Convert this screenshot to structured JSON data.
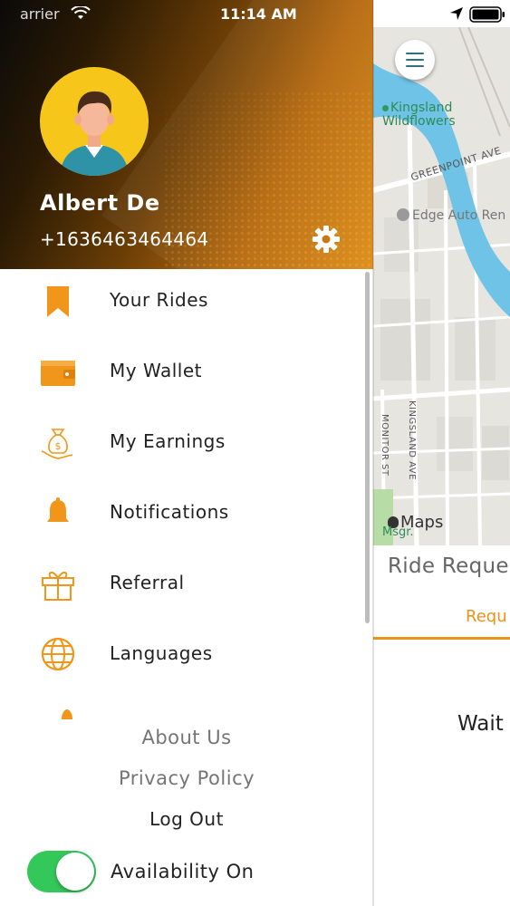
{
  "status_bar": {
    "carrier": "arrier",
    "time": "11:14 AM"
  },
  "profile": {
    "name": "Albert De",
    "phone": "+1636463464464"
  },
  "menu": [
    {
      "label": "Your Rides",
      "icon": "bookmark-icon"
    },
    {
      "label": "My Wallet",
      "icon": "wallet-icon"
    },
    {
      "label": "My Earnings",
      "icon": "money-bag-icon"
    },
    {
      "label": "Notifications",
      "icon": "bell-icon"
    },
    {
      "label": "Referral",
      "icon": "gift-icon"
    },
    {
      "label": "Languages",
      "icon": "globe-icon"
    }
  ],
  "footer": {
    "about": "About Us",
    "privacy": "Privacy Policy",
    "logout": "Log Out",
    "availability_label": "Availability On",
    "availability_on": true
  },
  "map": {
    "labels": [
      "Kingsland",
      "Wildflowers",
      "GREENPOINT AVE",
      "Edge Auto Ren",
      "KINGSLAND AVE",
      "MONITOR ST",
      "Maps",
      "Msgr."
    ]
  },
  "ride_panel": {
    "title": "Ride Reque",
    "tab": "Requ",
    "status": "Wait"
  },
  "colors": {
    "accent": "#e8931a",
    "toggle_on": "#34c759",
    "avatar_bg": "#f7c61a",
    "river": "#6fc3e6"
  }
}
